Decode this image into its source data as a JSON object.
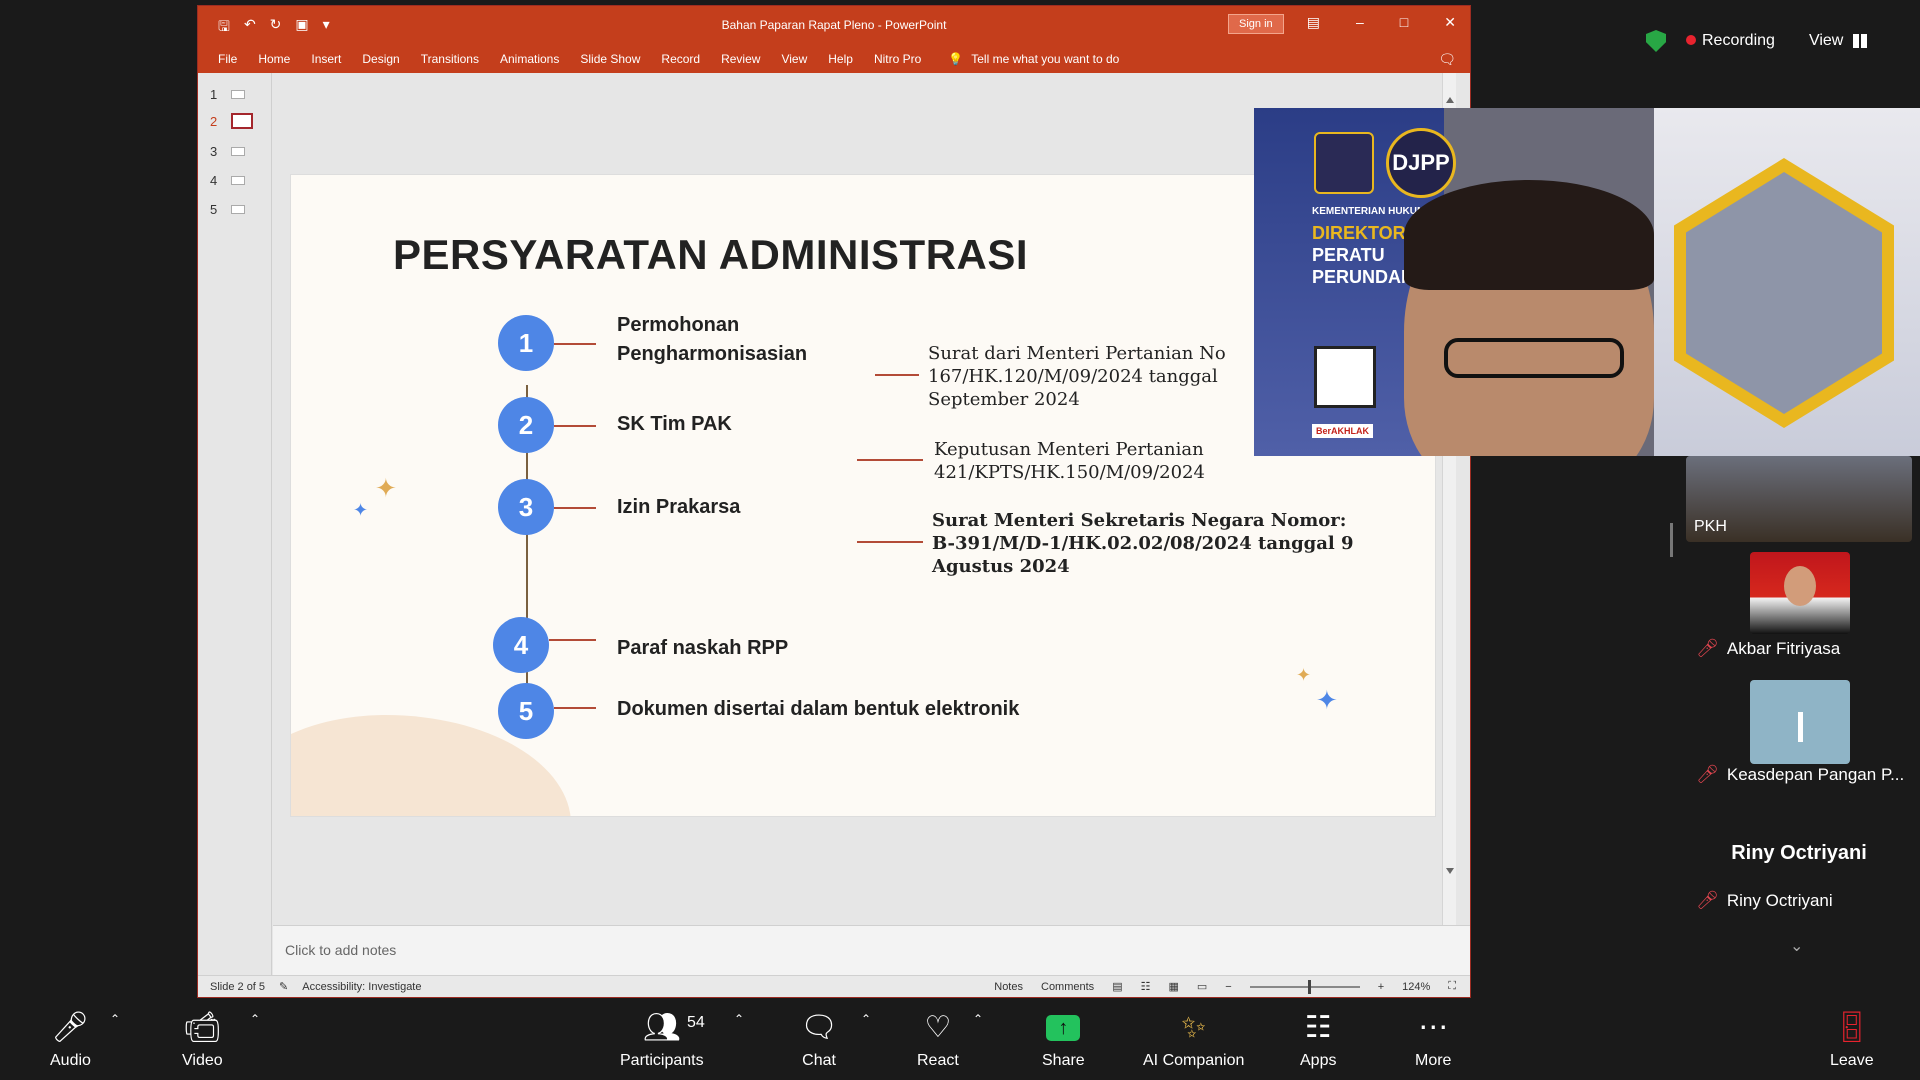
{
  "powerpoint": {
    "title": "Bahan Paparan Rapat Pleno - PowerPoint",
    "sign_in": "Sign in",
    "menu": [
      "File",
      "Home",
      "Insert",
      "Design",
      "Transitions",
      "Animations",
      "Slide Show",
      "Record",
      "Review",
      "View",
      "Help",
      "Nitro Pro"
    ],
    "tell_me": "Tell me what you want to do",
    "thumbnails": [
      "1",
      "2",
      "3",
      "4",
      "5"
    ],
    "notes_placeholder": "Click to add notes",
    "status": {
      "slide": "Slide 2 of 5",
      "accessibility": "Accessibility: Investigate",
      "notes": "Notes",
      "comments": "Comments",
      "zoom": "124%"
    }
  },
  "slide": {
    "title": "PERSYARATAN ADMINISTRASI",
    "items": [
      {
        "num": "1",
        "label": "Permohonan Pengharmonisasian",
        "desc": "Surat dari Menteri Pertanian No 167/HK.120/M/09/2024 tanggal September 2024"
      },
      {
        "num": "2",
        "label": "SK Tim PAK",
        "desc": "Keputusan Menteri Pertanian 421/KPTS/HK.150/M/09/2024"
      },
      {
        "num": "3",
        "label": "Izin Prakarsa",
        "desc": "Surat Menteri Sekretaris Negara Nomor: B-391/M/D-1/HK.02.02/08/2024 tanggal 9 Agustus 2024"
      },
      {
        "num": "4",
        "label": "Paraf naskah RPP",
        "desc": ""
      },
      {
        "num": "5",
        "label": "Dokumen disertai dalam bentuk elektronik",
        "desc": ""
      }
    ]
  },
  "meeting": {
    "recording": "Recording",
    "view": "View",
    "speaker_panel": {
      "ministry": "KEMENTERIAN HUKUM",
      "dir1": "DIREKTORA",
      "dir2": "PERATU",
      "dir3": "PERUNDAN",
      "logo": "DJPP",
      "tag": "BerAKHLAK"
    },
    "participants": [
      {
        "name": "PKH"
      },
      {
        "name": "Akbar Fitriyasa"
      },
      {
        "name": "Keasdepan Pangan P..."
      },
      {
        "name": "Riny Octriyani",
        "display": "Riny Octriyani"
      }
    ]
  },
  "toolbar": {
    "audio": "Audio",
    "video": "Video",
    "participants": "Participants",
    "participants_count": "54",
    "chat": "Chat",
    "react": "React",
    "share": "Share",
    "ai": "AI Companion",
    "apps": "Apps",
    "more": "More",
    "leave": "Leave"
  }
}
